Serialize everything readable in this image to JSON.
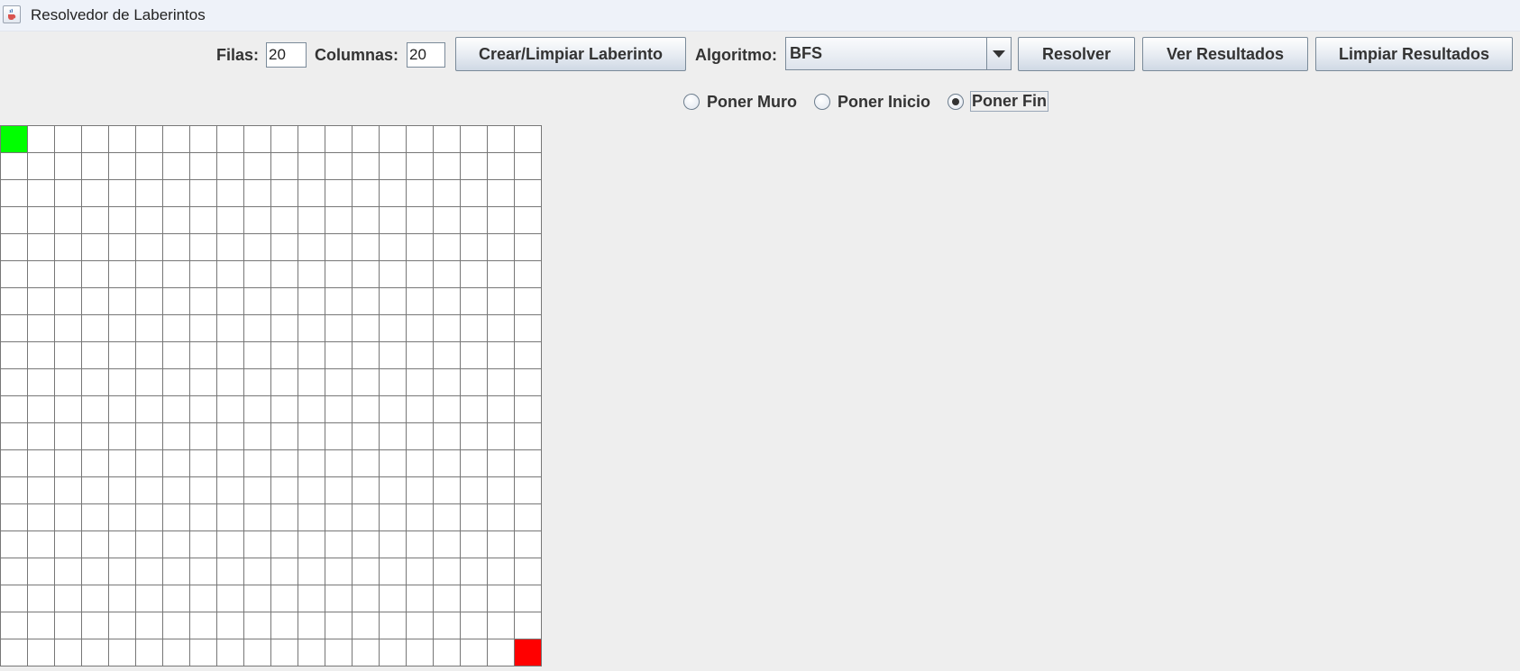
{
  "window": {
    "title": "Resolvedor de Laberintos",
    "icon": "java-cup-icon"
  },
  "toolbar": {
    "rows_label": "Filas:",
    "rows_value": "20",
    "cols_label": "Columnas:",
    "cols_value": "20",
    "create_button": "Crear/Limpiar Laberinto",
    "algorithm_label": "Algoritmo:",
    "algorithm_selected": "BFS",
    "solve_button": "Resolver",
    "view_results_button": "Ver Resultados",
    "clear_results_button": "Limpiar Resultados"
  },
  "mode": {
    "options": [
      "Poner Muro",
      "Poner Inicio",
      "Poner Fin"
    ],
    "selected": "Poner Fin"
  },
  "maze": {
    "rows": 20,
    "cols": 20,
    "start": [
      0,
      0
    ],
    "end": [
      19,
      19
    ],
    "walls": [],
    "colors": {
      "empty": "#ffffff",
      "start": "#00ff00",
      "end": "#ff0000",
      "grid_line": "#777777"
    }
  }
}
